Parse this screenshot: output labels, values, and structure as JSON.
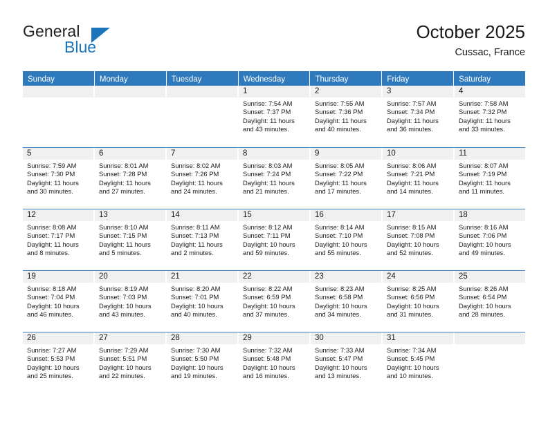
{
  "brand": {
    "name_part1": "General",
    "name_part2": "Blue",
    "flag_icon": "triangle-flag-icon"
  },
  "header": {
    "title": "October 2025",
    "location": "Cussac, France"
  },
  "colors": {
    "header_blue": "#2f79bd",
    "row_divider_blue": "#3a7fc1",
    "daynum_band": "#f0f0f0",
    "brand_blue": "#1b75bb",
    "text": "#1a1a1a"
  },
  "weekdays": [
    "Sunday",
    "Monday",
    "Tuesday",
    "Wednesday",
    "Thursday",
    "Friday",
    "Saturday"
  ],
  "labels": {
    "sunrise_prefix": "Sunrise:",
    "sunset_prefix": "Sunset:",
    "daylight_prefix": "Daylight:"
  },
  "weeks": [
    [
      {
        "empty": true
      },
      {
        "empty": true
      },
      {
        "empty": true
      },
      {
        "day": "1",
        "sunrise": "Sunrise: 7:54 AM",
        "sunset": "Sunset: 7:37 PM",
        "daylight_line1": "Daylight: 11 hours",
        "daylight_line2": "and 43 minutes."
      },
      {
        "day": "2",
        "sunrise": "Sunrise: 7:55 AM",
        "sunset": "Sunset: 7:36 PM",
        "daylight_line1": "Daylight: 11 hours",
        "daylight_line2": "and 40 minutes."
      },
      {
        "day": "3",
        "sunrise": "Sunrise: 7:57 AM",
        "sunset": "Sunset: 7:34 PM",
        "daylight_line1": "Daylight: 11 hours",
        "daylight_line2": "and 36 minutes."
      },
      {
        "day": "4",
        "sunrise": "Sunrise: 7:58 AM",
        "sunset": "Sunset: 7:32 PM",
        "daylight_line1": "Daylight: 11 hours",
        "daylight_line2": "and 33 minutes."
      }
    ],
    [
      {
        "day": "5",
        "sunrise": "Sunrise: 7:59 AM",
        "sunset": "Sunset: 7:30 PM",
        "daylight_line1": "Daylight: 11 hours",
        "daylight_line2": "and 30 minutes."
      },
      {
        "day": "6",
        "sunrise": "Sunrise: 8:01 AM",
        "sunset": "Sunset: 7:28 PM",
        "daylight_line1": "Daylight: 11 hours",
        "daylight_line2": "and 27 minutes."
      },
      {
        "day": "7",
        "sunrise": "Sunrise: 8:02 AM",
        "sunset": "Sunset: 7:26 PM",
        "daylight_line1": "Daylight: 11 hours",
        "daylight_line2": "and 24 minutes."
      },
      {
        "day": "8",
        "sunrise": "Sunrise: 8:03 AM",
        "sunset": "Sunset: 7:24 PM",
        "daylight_line1": "Daylight: 11 hours",
        "daylight_line2": "and 21 minutes."
      },
      {
        "day": "9",
        "sunrise": "Sunrise: 8:05 AM",
        "sunset": "Sunset: 7:22 PM",
        "daylight_line1": "Daylight: 11 hours",
        "daylight_line2": "and 17 minutes."
      },
      {
        "day": "10",
        "sunrise": "Sunrise: 8:06 AM",
        "sunset": "Sunset: 7:21 PM",
        "daylight_line1": "Daylight: 11 hours",
        "daylight_line2": "and 14 minutes."
      },
      {
        "day": "11",
        "sunrise": "Sunrise: 8:07 AM",
        "sunset": "Sunset: 7:19 PM",
        "daylight_line1": "Daylight: 11 hours",
        "daylight_line2": "and 11 minutes."
      }
    ],
    [
      {
        "day": "12",
        "sunrise": "Sunrise: 8:08 AM",
        "sunset": "Sunset: 7:17 PM",
        "daylight_line1": "Daylight: 11 hours",
        "daylight_line2": "and 8 minutes."
      },
      {
        "day": "13",
        "sunrise": "Sunrise: 8:10 AM",
        "sunset": "Sunset: 7:15 PM",
        "daylight_line1": "Daylight: 11 hours",
        "daylight_line2": "and 5 minutes."
      },
      {
        "day": "14",
        "sunrise": "Sunrise: 8:11 AM",
        "sunset": "Sunset: 7:13 PM",
        "daylight_line1": "Daylight: 11 hours",
        "daylight_line2": "and 2 minutes."
      },
      {
        "day": "15",
        "sunrise": "Sunrise: 8:12 AM",
        "sunset": "Sunset: 7:11 PM",
        "daylight_line1": "Daylight: 10 hours",
        "daylight_line2": "and 59 minutes."
      },
      {
        "day": "16",
        "sunrise": "Sunrise: 8:14 AM",
        "sunset": "Sunset: 7:10 PM",
        "daylight_line1": "Daylight: 10 hours",
        "daylight_line2": "and 55 minutes."
      },
      {
        "day": "17",
        "sunrise": "Sunrise: 8:15 AM",
        "sunset": "Sunset: 7:08 PM",
        "daylight_line1": "Daylight: 10 hours",
        "daylight_line2": "and 52 minutes."
      },
      {
        "day": "18",
        "sunrise": "Sunrise: 8:16 AM",
        "sunset": "Sunset: 7:06 PM",
        "daylight_line1": "Daylight: 10 hours",
        "daylight_line2": "and 49 minutes."
      }
    ],
    [
      {
        "day": "19",
        "sunrise": "Sunrise: 8:18 AM",
        "sunset": "Sunset: 7:04 PM",
        "daylight_line1": "Daylight: 10 hours",
        "daylight_line2": "and 46 minutes."
      },
      {
        "day": "20",
        "sunrise": "Sunrise: 8:19 AM",
        "sunset": "Sunset: 7:03 PM",
        "daylight_line1": "Daylight: 10 hours",
        "daylight_line2": "and 43 minutes."
      },
      {
        "day": "21",
        "sunrise": "Sunrise: 8:20 AM",
        "sunset": "Sunset: 7:01 PM",
        "daylight_line1": "Daylight: 10 hours",
        "daylight_line2": "and 40 minutes."
      },
      {
        "day": "22",
        "sunrise": "Sunrise: 8:22 AM",
        "sunset": "Sunset: 6:59 PM",
        "daylight_line1": "Daylight: 10 hours",
        "daylight_line2": "and 37 minutes."
      },
      {
        "day": "23",
        "sunrise": "Sunrise: 8:23 AM",
        "sunset": "Sunset: 6:58 PM",
        "daylight_line1": "Daylight: 10 hours",
        "daylight_line2": "and 34 minutes."
      },
      {
        "day": "24",
        "sunrise": "Sunrise: 8:25 AM",
        "sunset": "Sunset: 6:56 PM",
        "daylight_line1": "Daylight: 10 hours",
        "daylight_line2": "and 31 minutes."
      },
      {
        "day": "25",
        "sunrise": "Sunrise: 8:26 AM",
        "sunset": "Sunset: 6:54 PM",
        "daylight_line1": "Daylight: 10 hours",
        "daylight_line2": "and 28 minutes."
      }
    ],
    [
      {
        "day": "26",
        "sunrise": "Sunrise: 7:27 AM",
        "sunset": "Sunset: 5:53 PM",
        "daylight_line1": "Daylight: 10 hours",
        "daylight_line2": "and 25 minutes."
      },
      {
        "day": "27",
        "sunrise": "Sunrise: 7:29 AM",
        "sunset": "Sunset: 5:51 PM",
        "daylight_line1": "Daylight: 10 hours",
        "daylight_line2": "and 22 minutes."
      },
      {
        "day": "28",
        "sunrise": "Sunrise: 7:30 AM",
        "sunset": "Sunset: 5:50 PM",
        "daylight_line1": "Daylight: 10 hours",
        "daylight_line2": "and 19 minutes."
      },
      {
        "day": "29",
        "sunrise": "Sunrise: 7:32 AM",
        "sunset": "Sunset: 5:48 PM",
        "daylight_line1": "Daylight: 10 hours",
        "daylight_line2": "and 16 minutes."
      },
      {
        "day": "30",
        "sunrise": "Sunrise: 7:33 AM",
        "sunset": "Sunset: 5:47 PM",
        "daylight_line1": "Daylight: 10 hours",
        "daylight_line2": "and 13 minutes."
      },
      {
        "day": "31",
        "sunrise": "Sunrise: 7:34 AM",
        "sunset": "Sunset: 5:45 PM",
        "daylight_line1": "Daylight: 10 hours",
        "daylight_line2": "and 10 minutes."
      },
      {
        "empty": true
      }
    ]
  ]
}
